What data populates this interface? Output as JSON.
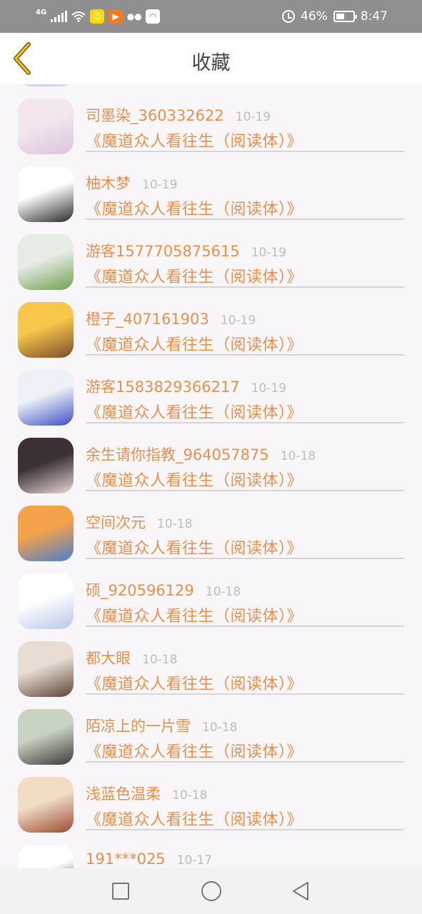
{
  "status": {
    "signal": "4G",
    "battery": "46%",
    "time": "8:47"
  },
  "header": {
    "title": "收藏"
  },
  "accent": "#e5914e",
  "rows": [
    {
      "name": "司墨染_360332622",
      "date": "10-19",
      "book": "《魔道众人看往生（阅读体）》",
      "avatar_colors": [
        "#f3e6ef",
        "#d9c4dd"
      ]
    },
    {
      "name": "柚木梦",
      "date": "10-19",
      "book": "《魔道众人看往生（阅读体）》",
      "avatar_colors": [
        "#ffffff",
        "#2a2a2a"
      ]
    },
    {
      "name": "游客1577705875615",
      "date": "10-19",
      "book": "《魔道众人看往生（阅读体）》",
      "avatar_colors": [
        "#e8ece6",
        "#6fa04f"
      ]
    },
    {
      "name": "橙子_407161903",
      "date": "10-19",
      "book": "《魔道众人看往生（阅读体）》",
      "avatar_colors": [
        "#f8c64a",
        "#7a4c2a"
      ]
    },
    {
      "name": "游客1583829366217",
      "date": "10-19",
      "book": "《魔道众人看往生（阅读体）》",
      "avatar_colors": [
        "#eef2f8",
        "#3f4fc0"
      ]
    },
    {
      "name": "余生请你指教_964057875",
      "date": "10-18",
      "book": "《魔道众人看往生（阅读体）》",
      "avatar_colors": [
        "#3a3035",
        "#e9d6d2"
      ]
    },
    {
      "name": "空间次元",
      "date": "10-18",
      "book": "《魔道众人看往生（阅读体）》",
      "avatar_colors": [
        "#f3a24a",
        "#4a7ed0"
      ]
    },
    {
      "name": "硕_920596129",
      "date": "10-18",
      "book": "《魔道众人看往生（阅读体）》",
      "avatar_colors": [
        "#ffffff",
        "#b8c8e8"
      ]
    },
    {
      "name": "都大眼",
      "date": "10-18",
      "book": "《魔道众人看往生（阅读体）》",
      "avatar_colors": [
        "#e8ddd2",
        "#5a4436"
      ]
    },
    {
      "name": "陌凉上的一片雪",
      "date": "10-18",
      "book": "《魔道众人看往生（阅读体）》",
      "avatar_colors": [
        "#c9d3c4",
        "#3d3a3a"
      ]
    },
    {
      "name": "浅蓝色温柔",
      "date": "10-18",
      "book": "《魔道众人看往生（阅读体）》",
      "avatar_colors": [
        "#f1dcc4",
        "#9a4c32"
      ]
    },
    {
      "name": "191***025",
      "date": "10-17",
      "book": "",
      "avatar_colors": [
        "#ffffff",
        "#111111"
      ]
    }
  ]
}
